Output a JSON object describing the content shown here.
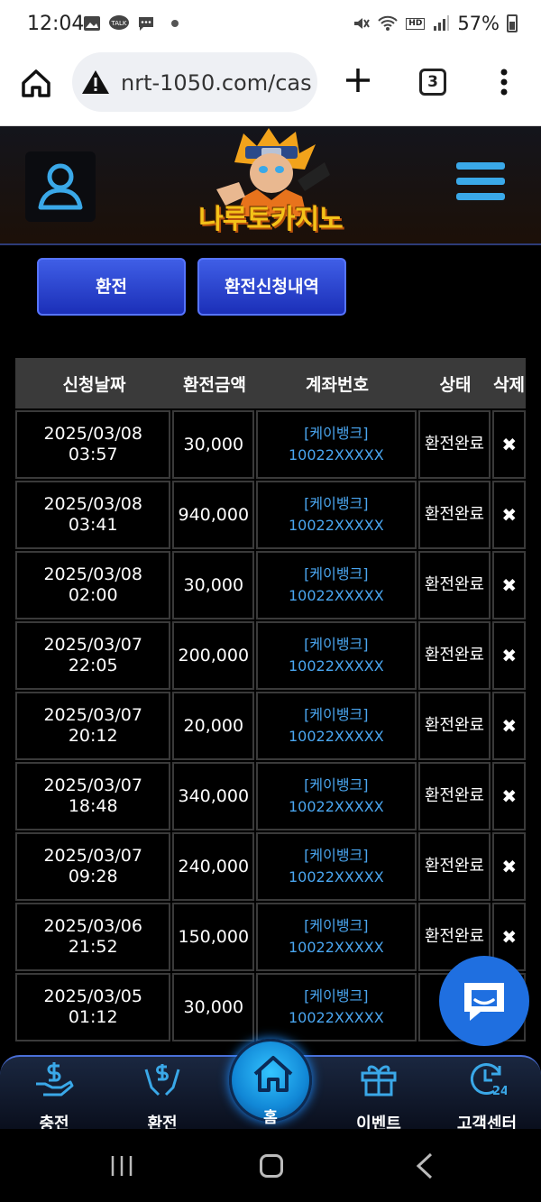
{
  "status_bar": {
    "time": "12:04",
    "talk_badge": "TALK",
    "battery": "57%",
    "hd_label": "HD"
  },
  "browser": {
    "url": "nrt-1050.com/cas",
    "tab_count": "3"
  },
  "site": {
    "logo_text": "나루토카지노"
  },
  "tabs": {
    "exchange": "환전",
    "history": "환전신청내역"
  },
  "table": {
    "headers": [
      "신청날짜",
      "환전금액",
      "계좌번호",
      "상태",
      "삭제"
    ],
    "rows": [
      {
        "date": "2025/03/08",
        "time": "03:57",
        "amount": "30,000",
        "bank": "[케이뱅크]",
        "account": "10022XXXXX",
        "status": "환전완료",
        "delete": "✖"
      },
      {
        "date": "2025/03/08",
        "time": "03:41",
        "amount": "940,000",
        "bank": "[케이뱅크]",
        "account": "10022XXXXX",
        "status": "환전완료",
        "delete": "✖"
      },
      {
        "date": "2025/03/08",
        "time": "02:00",
        "amount": "30,000",
        "bank": "[케이뱅크]",
        "account": "10022XXXXX",
        "status": "환전완료",
        "delete": "✖"
      },
      {
        "date": "2025/03/07",
        "time": "22:05",
        "amount": "200,000",
        "bank": "[케이뱅크]",
        "account": "10022XXXXX",
        "status": "환전완료",
        "delete": "✖"
      },
      {
        "date": "2025/03/07",
        "time": "20:12",
        "amount": "20,000",
        "bank": "[케이뱅크]",
        "account": "10022XXXXX",
        "status": "환전완료",
        "delete": "✖"
      },
      {
        "date": "2025/03/07",
        "time": "18:48",
        "amount": "340,000",
        "bank": "[케이뱅크]",
        "account": "10022XXXXX",
        "status": "환전완료",
        "delete": "✖"
      },
      {
        "date": "2025/03/07",
        "time": "09:28",
        "amount": "240,000",
        "bank": "[케이뱅크]",
        "account": "10022XXXXX",
        "status": "환전완료",
        "delete": "✖"
      },
      {
        "date": "2025/03/06",
        "time": "21:52",
        "amount": "150,000",
        "bank": "[케이뱅크]",
        "account": "10022XXXXX",
        "status": "환전완료",
        "delete": "✖"
      },
      {
        "date": "2025/03/05",
        "time": "01:12",
        "amount": "30,000",
        "bank": "[케이뱅크]",
        "account": "10022XXXXX",
        "status": "환",
        "delete": ""
      }
    ]
  },
  "bottom_nav": {
    "charge": "충전",
    "exchange": "환전",
    "home": "홈",
    "event": "이벤트",
    "support": "고객센터"
  },
  "colors": {
    "accent": "#3aa8e8",
    "tab_button": "#2a44d0",
    "account_text": "#4aa6f0"
  }
}
